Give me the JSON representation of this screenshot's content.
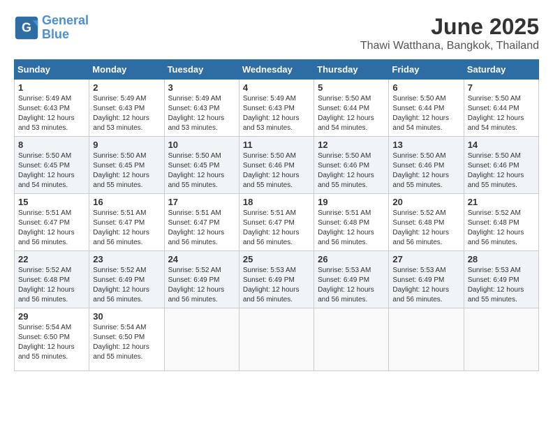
{
  "header": {
    "logo_line1": "General",
    "logo_line2": "Blue",
    "month": "June 2025",
    "location": "Thawi Watthana, Bangkok, Thailand"
  },
  "days_of_week": [
    "Sunday",
    "Monday",
    "Tuesday",
    "Wednesday",
    "Thursday",
    "Friday",
    "Saturday"
  ],
  "weeks": [
    [
      {
        "day": 1,
        "sunrise": "5:49 AM",
        "sunset": "6:43 PM",
        "daylight": "12 hours and 53 minutes."
      },
      {
        "day": 2,
        "sunrise": "5:49 AM",
        "sunset": "6:43 PM",
        "daylight": "12 hours and 53 minutes."
      },
      {
        "day": 3,
        "sunrise": "5:49 AM",
        "sunset": "6:43 PM",
        "daylight": "12 hours and 53 minutes."
      },
      {
        "day": 4,
        "sunrise": "5:49 AM",
        "sunset": "6:43 PM",
        "daylight": "12 hours and 53 minutes."
      },
      {
        "day": 5,
        "sunrise": "5:50 AM",
        "sunset": "6:44 PM",
        "daylight": "12 hours and 54 minutes."
      },
      {
        "day": 6,
        "sunrise": "5:50 AM",
        "sunset": "6:44 PM",
        "daylight": "12 hours and 54 minutes."
      },
      {
        "day": 7,
        "sunrise": "5:50 AM",
        "sunset": "6:44 PM",
        "daylight": "12 hours and 54 minutes."
      }
    ],
    [
      {
        "day": 8,
        "sunrise": "5:50 AM",
        "sunset": "6:45 PM",
        "daylight": "12 hours and 54 minutes."
      },
      {
        "day": 9,
        "sunrise": "5:50 AM",
        "sunset": "6:45 PM",
        "daylight": "12 hours and 55 minutes."
      },
      {
        "day": 10,
        "sunrise": "5:50 AM",
        "sunset": "6:45 PM",
        "daylight": "12 hours and 55 minutes."
      },
      {
        "day": 11,
        "sunrise": "5:50 AM",
        "sunset": "6:46 PM",
        "daylight": "12 hours and 55 minutes."
      },
      {
        "day": 12,
        "sunrise": "5:50 AM",
        "sunset": "6:46 PM",
        "daylight": "12 hours and 55 minutes."
      },
      {
        "day": 13,
        "sunrise": "5:50 AM",
        "sunset": "6:46 PM",
        "daylight": "12 hours and 55 minutes."
      },
      {
        "day": 14,
        "sunrise": "5:50 AM",
        "sunset": "6:46 PM",
        "daylight": "12 hours and 55 minutes."
      }
    ],
    [
      {
        "day": 15,
        "sunrise": "5:51 AM",
        "sunset": "6:47 PM",
        "daylight": "12 hours and 56 minutes."
      },
      {
        "day": 16,
        "sunrise": "5:51 AM",
        "sunset": "6:47 PM",
        "daylight": "12 hours and 56 minutes."
      },
      {
        "day": 17,
        "sunrise": "5:51 AM",
        "sunset": "6:47 PM",
        "daylight": "12 hours and 56 minutes."
      },
      {
        "day": 18,
        "sunrise": "5:51 AM",
        "sunset": "6:47 PM",
        "daylight": "12 hours and 56 minutes."
      },
      {
        "day": 19,
        "sunrise": "5:51 AM",
        "sunset": "6:48 PM",
        "daylight": "12 hours and 56 minutes."
      },
      {
        "day": 20,
        "sunrise": "5:52 AM",
        "sunset": "6:48 PM",
        "daylight": "12 hours and 56 minutes."
      },
      {
        "day": 21,
        "sunrise": "5:52 AM",
        "sunset": "6:48 PM",
        "daylight": "12 hours and 56 minutes."
      }
    ],
    [
      {
        "day": 22,
        "sunrise": "5:52 AM",
        "sunset": "6:48 PM",
        "daylight": "12 hours and 56 minutes."
      },
      {
        "day": 23,
        "sunrise": "5:52 AM",
        "sunset": "6:49 PM",
        "daylight": "12 hours and 56 minutes."
      },
      {
        "day": 24,
        "sunrise": "5:52 AM",
        "sunset": "6:49 PM",
        "daylight": "12 hours and 56 minutes."
      },
      {
        "day": 25,
        "sunrise": "5:53 AM",
        "sunset": "6:49 PM",
        "daylight": "12 hours and 56 minutes."
      },
      {
        "day": 26,
        "sunrise": "5:53 AM",
        "sunset": "6:49 PM",
        "daylight": "12 hours and 56 minutes."
      },
      {
        "day": 27,
        "sunrise": "5:53 AM",
        "sunset": "6:49 PM",
        "daylight": "12 hours and 56 minutes."
      },
      {
        "day": 28,
        "sunrise": "5:53 AM",
        "sunset": "6:49 PM",
        "daylight": "12 hours and 55 minutes."
      }
    ],
    [
      {
        "day": 29,
        "sunrise": "5:54 AM",
        "sunset": "6:50 PM",
        "daylight": "12 hours and 55 minutes."
      },
      {
        "day": 30,
        "sunrise": "5:54 AM",
        "sunset": "6:50 PM",
        "daylight": "12 hours and 55 minutes."
      },
      null,
      null,
      null,
      null,
      null
    ]
  ]
}
